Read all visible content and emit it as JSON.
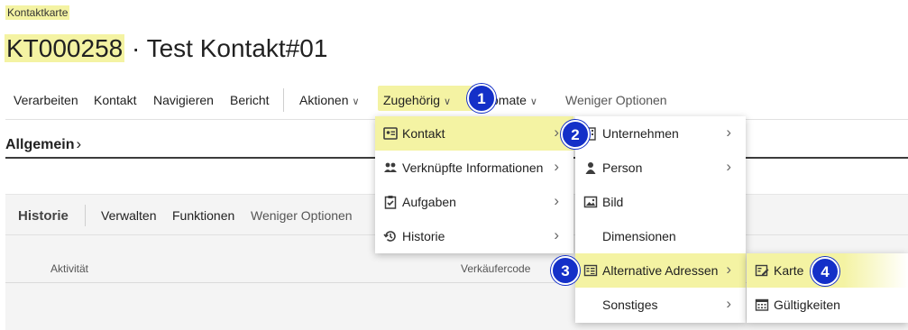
{
  "breadcrumb": "Kontaktkarte",
  "title": {
    "code": "KT000258",
    "separator": " · ",
    "name": "Test Kontakt#01"
  },
  "actionbar": {
    "verarbeiten": "Verarbeiten",
    "kontakt": "Kontakt",
    "navigieren": "Navigieren",
    "bericht": "Bericht",
    "aktionen": "Aktionen",
    "zugehoerig": "Zugehörig",
    "automate": "omate",
    "weniger": "Weniger Optionen"
  },
  "allgemein": "Allgemein",
  "historie": {
    "title": "Historie",
    "verwalten": "Verwalten",
    "funktionen": "Funktionen",
    "weniger": "Weniger Optionen",
    "col_aktivitaet": "Aktivität",
    "col_verkaeufer": "Verkäufercode"
  },
  "menu1": {
    "kontakt": "Kontakt",
    "verknuepfte": "Verknüpfte Informationen",
    "aufgaben": "Aufgaben",
    "historie": "Historie"
  },
  "menu2": {
    "unternehmen": "Unternehmen",
    "person": "Person",
    "bild": "Bild",
    "dimensionen": "Dimensionen",
    "alt_adressen": "Alternative Adressen",
    "sonstiges": "Sonstiges"
  },
  "menu3": {
    "karte": "Karte",
    "gueltigkeiten": "Gültigkeiten"
  },
  "badges": [
    "1",
    "2",
    "3",
    "4"
  ],
  "colors": {
    "highlight": "#f4f3a3",
    "badge": "#1430c8"
  }
}
